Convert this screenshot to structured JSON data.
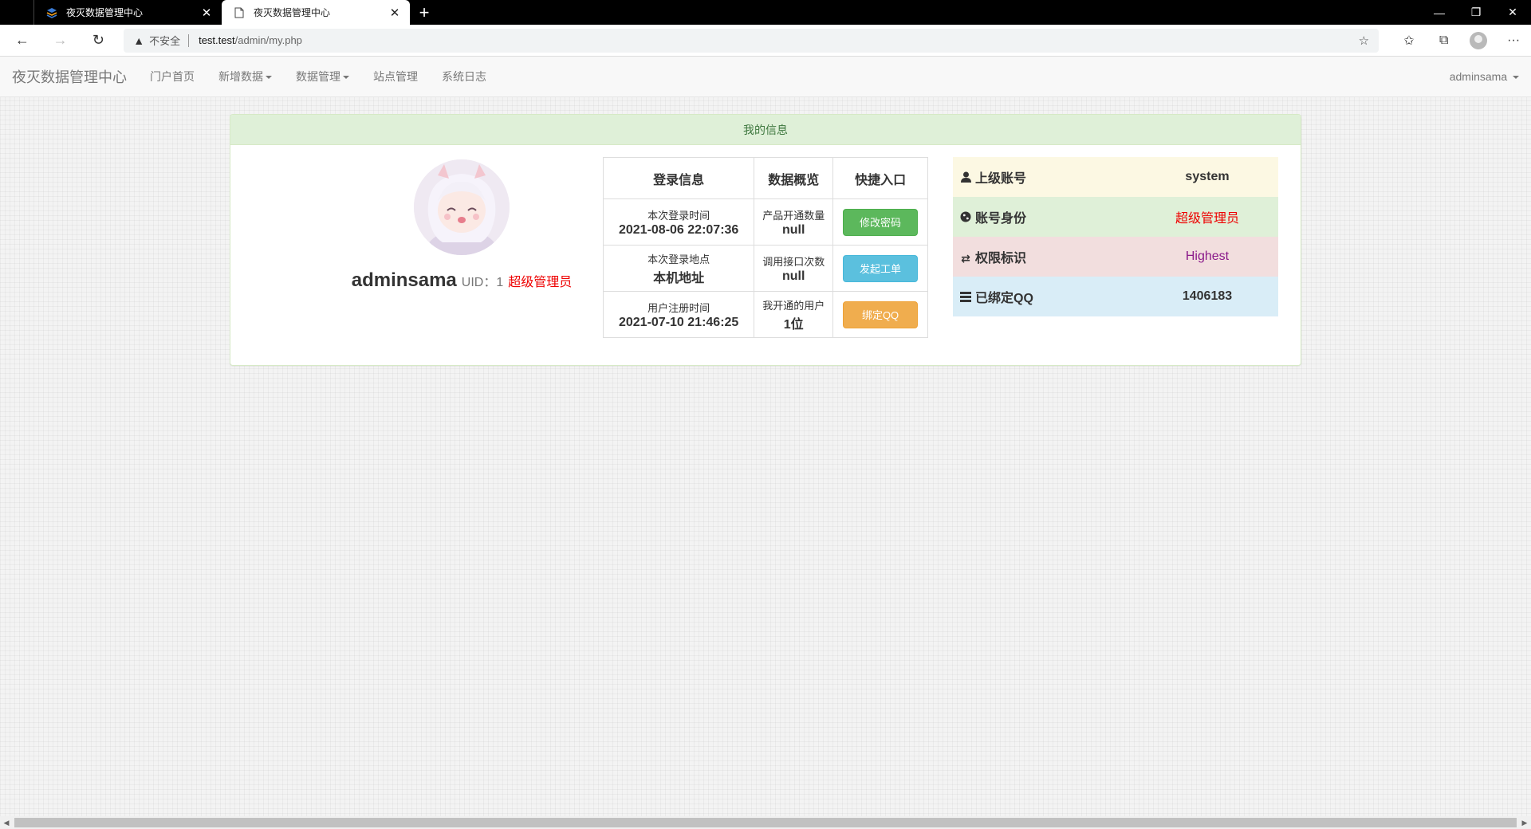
{
  "browser": {
    "tabs": [
      {
        "title": "夜灭数据管理中心",
        "active": false
      },
      {
        "title": "夜灭数据管理中心",
        "active": true
      }
    ],
    "address": {
      "insecure_label": "不安全",
      "host": "test.test",
      "path": "/admin/my.php"
    }
  },
  "navbar": {
    "brand": "夜灭数据管理中心",
    "items": [
      {
        "label": "门户首页",
        "dropdown": false
      },
      {
        "label": "新增数据",
        "dropdown": true
      },
      {
        "label": "数据管理",
        "dropdown": true
      },
      {
        "label": "站点管理",
        "dropdown": false
      },
      {
        "label": "系统日志",
        "dropdown": false
      }
    ],
    "user": "adminsama"
  },
  "panel": {
    "title": "我的信息",
    "profile": {
      "name": "adminsama",
      "uid_label": "UID：",
      "uid": "1",
      "role": "超级管理员"
    },
    "info_table": {
      "headers": [
        "登录信息",
        "数据概览",
        "快捷入口"
      ],
      "rows": [
        {
          "login_label": "本次登录时间",
          "login_value": "2021-08-06 22:07:36",
          "data_label": "产品开通数量",
          "data_value": "null",
          "button": "修改密码"
        },
        {
          "login_label": "本次登录地点",
          "login_value": "本机地址",
          "data_label": "调用接口次数",
          "data_value": "null",
          "button": "发起工单"
        },
        {
          "login_label": "用户注册时间",
          "login_value": "2021-07-10 21:46:25",
          "data_label": "我开通的用户",
          "data_value": "1位",
          "button": "绑定QQ"
        }
      ]
    },
    "status_table": [
      {
        "label": "上级账号",
        "value": "system",
        "icon": "user-icon"
      },
      {
        "label": "账号身份",
        "value": "超级管理员",
        "icon": "globe-icon"
      },
      {
        "label": "权限标识",
        "value": "Highest",
        "icon": "transfer-icon"
      },
      {
        "label": "已绑定QQ",
        "value": "1406183",
        "icon": "list-icon"
      }
    ]
  },
  "colors": {
    "panel_heading_bg": "#dff0d8",
    "danger_text": "#e00000",
    "btn_success": "#5cb85c",
    "btn_info": "#5bc0de",
    "btn_warning": "#f0ad4e"
  }
}
